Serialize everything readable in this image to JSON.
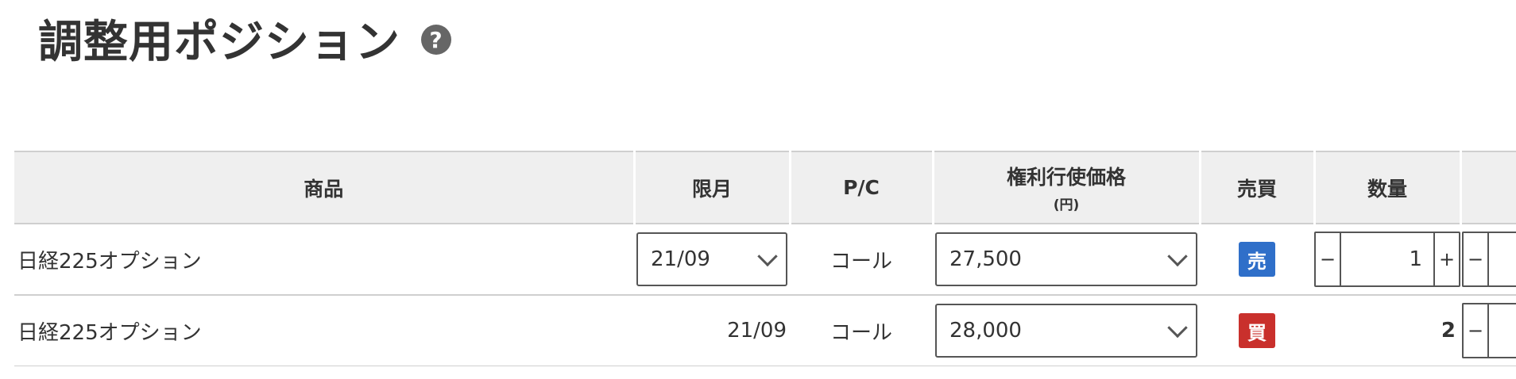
{
  "title": "調整用ポジション",
  "help_glyph": "?",
  "columns": {
    "product": "商品",
    "month": "限月",
    "pc": "P/C",
    "strike": "権利行使価格",
    "strike_unit": "(円)",
    "side": "売買",
    "qty": "数量",
    "extra": ""
  },
  "rows": [
    {
      "product": "日経225オプション",
      "month": "21/09",
      "pc": "コール",
      "strike": "27,500",
      "side": "売",
      "side_color": "#2f6fc9",
      "qty": "1",
      "minus": "−",
      "plus": "+"
    },
    {
      "product": "日経225オプション",
      "month": "21/09",
      "pc": "コール",
      "strike": "28,000",
      "side": "買",
      "side_color": "#c9302c",
      "qty": "2",
      "minus": "−"
    }
  ]
}
